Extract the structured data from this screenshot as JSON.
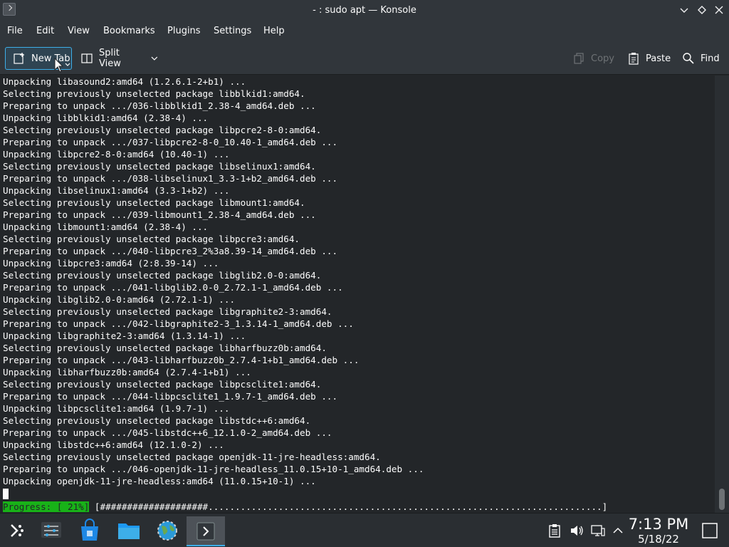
{
  "window": {
    "title": "- : sudo apt — Konsole",
    "app_icon": "terminal-icon",
    "controls": [
      "minimize",
      "maximize",
      "close"
    ]
  },
  "menu": [
    "File",
    "Edit",
    "View",
    "Bookmarks",
    "Plugins",
    "Settings",
    "Help"
  ],
  "toolbar": {
    "new_tab": "New Tab",
    "split_view": "Split View",
    "copy": "Copy",
    "paste": "Paste",
    "find": "Find"
  },
  "terminal": {
    "lines": [
      "Unpacking libasound2:amd64 (1.2.6.1-2+b1) ...",
      "Selecting previously unselected package libblkid1:amd64.",
      "Preparing to unpack .../036-libblkid1_2.38-4_amd64.deb ...",
      "Unpacking libblkid1:amd64 (2.38-4) ...",
      "Selecting previously unselected package libpcre2-8-0:amd64.",
      "Preparing to unpack .../037-libpcre2-8-0_10.40-1_amd64.deb ...",
      "Unpacking libpcre2-8-0:amd64 (10.40-1) ...",
      "Selecting previously unselected package libselinux1:amd64.",
      "Preparing to unpack .../038-libselinux1_3.3-1+b2_amd64.deb ...",
      "Unpacking libselinux1:amd64 (3.3-1+b2) ...",
      "Selecting previously unselected package libmount1:amd64.",
      "Preparing to unpack .../039-libmount1_2.38-4_amd64.deb ...",
      "Unpacking libmount1:amd64 (2.38-4) ...",
      "Selecting previously unselected package libpcre3:amd64.",
      "Preparing to unpack .../040-libpcre3_2%3a8.39-14_amd64.deb ...",
      "Unpacking libpcre3:amd64 (2:8.39-14) ...",
      "Selecting previously unselected package libglib2.0-0:amd64.",
      "Preparing to unpack .../041-libglib2.0-0_2.72.1-1_amd64.deb ...",
      "Unpacking libglib2.0-0:amd64 (2.72.1-1) ...",
      "Selecting previously unselected package libgraphite2-3:amd64.",
      "Preparing to unpack .../042-libgraphite2-3_1.3.14-1_amd64.deb ...",
      "Unpacking libgraphite2-3:amd64 (1.3.14-1) ...",
      "Selecting previously unselected package libharfbuzz0b:amd64.",
      "Preparing to unpack .../043-libharfbuzz0b_2.7.4-1+b1_amd64.deb ...",
      "Unpacking libharfbuzz0b:amd64 (2.7.4-1+b1) ...",
      "Selecting previously unselected package libpcsclite1:amd64.",
      "Preparing to unpack .../044-libpcsclite1_1.9.7-1_amd64.deb ...",
      "Unpacking libpcsclite1:amd64 (1.9.7-1) ...",
      "Selecting previously unselected package libstdc++6:amd64.",
      "Preparing to unpack .../045-libstdc++6_12.1.0-2_amd64.deb ...",
      "Unpacking libstdc++6:amd64 (12.1.0-2) ...",
      "Selecting previously unselected package openjdk-11-jre-headless:amd64.",
      "Preparing to unpack .../046-openjdk-11-jre-headless_11.0.15+10-1_amd64.deb ...",
      "Unpacking openjdk-11-jre-headless:amd64 (11.0.15+10-1) ..."
    ],
    "progress_label": "Progress: [ 21%]",
    "progress_bar": " [####################.........................................................................]",
    "progress_percent": 21
  },
  "taskbar": {
    "icons": [
      "application-launcher-icon",
      "system-settings-icon",
      "discover-store-icon",
      "file-manager-icon",
      "web-browser-icon",
      "konsole-icon"
    ],
    "tray_icons": [
      "clipboard-icon",
      "volume-icon",
      "network-icon",
      "expand-tray-icon"
    ],
    "time": "7:13 PM",
    "date": "5/18/22"
  },
  "colors": {
    "window_bg": "#31363b",
    "terminal_bg": "#232629",
    "accent": "#3daee9",
    "progress_green": "#18b218"
  }
}
